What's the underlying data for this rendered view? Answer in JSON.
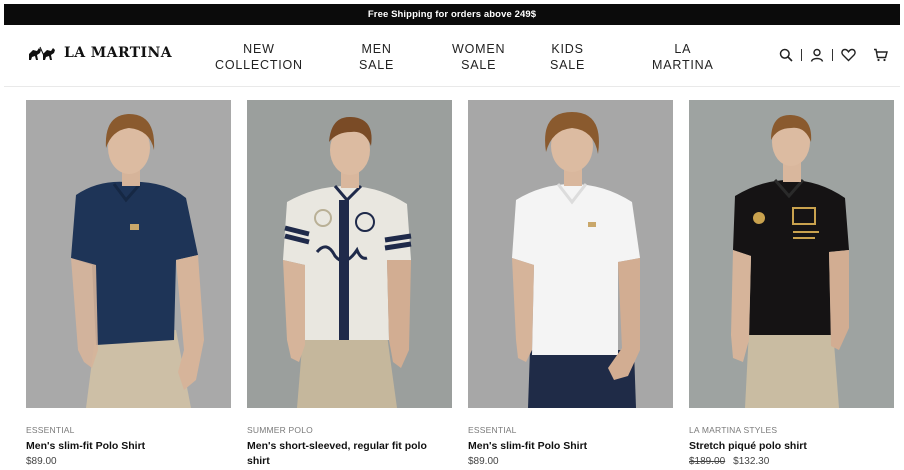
{
  "announcement": "Free Shipping for orders above 249$",
  "brand": {
    "name": "LA MARTINA"
  },
  "nav": [
    {
      "line1": "NEW",
      "line2": "COLLECTION"
    },
    {
      "line1": "MEN",
      "line2": "SALE"
    },
    {
      "line1": "WOMEN",
      "line2": "SALE"
    },
    {
      "line1": "KIDS",
      "line2": "SALE"
    },
    {
      "line1": "LA",
      "line2": "MARTINA"
    }
  ],
  "header_icons": [
    "search-icon",
    "user-icon",
    "heart-icon",
    "cart-icon"
  ],
  "products": [
    {
      "category": "ESSENTIAL",
      "name": "Men's slim-fit Polo Shirt",
      "price": "$89.00",
      "old_price": "",
      "shirt_color": "#1e3457",
      "pants_color": "#cdbfa6"
    },
    {
      "category": "SUMMER POLO",
      "name": "Men's short-sleeved, regular fit polo shirt",
      "price": "",
      "old_price": "",
      "shirt_color": "#e9e7e0",
      "pants_color": "#c5b79c"
    },
    {
      "category": "ESSENTIAL",
      "name": "Men's slim-fit Polo Shirt",
      "price": "$89.00",
      "old_price": "",
      "shirt_color": "#f4f4f4",
      "pants_color": "#1f2b47"
    },
    {
      "category": "LA MARTINA STYLES",
      "name": "Stretch piqué polo shirt",
      "price": "$132.30",
      "old_price": "$189.00",
      "shirt_color": "#151314",
      "pants_color": "#c9bca2"
    }
  ]
}
